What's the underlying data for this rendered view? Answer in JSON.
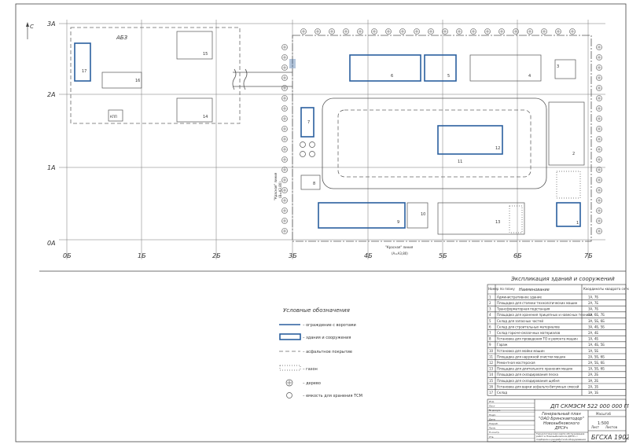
{
  "axes": {
    "rows": [
      "3А",
      "2А",
      "1А",
      "0А"
    ],
    "cols": [
      "0Б",
      "1Б",
      "2Б",
      "3Б",
      "4Б",
      "5Б",
      "6Б",
      "7Б"
    ],
    "north": "С"
  },
  "plan_labels": {
    "abz": "АБЗ",
    "kpp": "КПП",
    "red_line_1": "\"Красная\" линия",
    "red_line_1_coord": "(В=А3,80)",
    "red_line_2": "\"Красная\" линия",
    "red_line_2_coord": "(А=А3,80)"
  },
  "building_numbers": [
    "17",
    "16",
    "15",
    "14",
    "6",
    "5",
    "4",
    "3",
    "2",
    "1",
    "7",
    "8",
    "9",
    "10",
    "11",
    "12",
    "13"
  ],
  "legend": {
    "title": "Условные обозначения",
    "items": [
      {
        "icon": "fence-with-gate-icon",
        "text": "– ограждение с воротами"
      },
      {
        "icon": "building-outline-icon",
        "text": "– здания и сооружения"
      },
      {
        "icon": "dashed-line-icon",
        "text": "– асфальтное покрытие"
      },
      {
        "icon": "lawn-icon",
        "text": "– газон"
      },
      {
        "icon": "tree-icon",
        "text": "– дерево"
      },
      {
        "icon": "tank-icon",
        "text": "– емкость для хранения ТСМ"
      }
    ]
  },
  "explication": {
    "title": "Экспликация зданий и сооружений",
    "headers": [
      "Номер по плану",
      "Наименование",
      "Координаты квадрата сетки"
    ],
    "rows": [
      [
        "1",
        "Административное здание",
        "1А, 7Б"
      ],
      [
        "2",
        "Площадка для стоянки технологических машин",
        "2А, 7Б"
      ],
      [
        "3",
        "Трансформаторная подстанция",
        "3А, 7Б"
      ],
      [
        "4",
        "Площадка для хранения прицепных и навесных техники",
        "3А, 6Б, 7Б"
      ],
      [
        "5",
        "Склад для запасных частей",
        "3А, 5Б, 6Б"
      ],
      [
        "6",
        "Склад для строительных материалов",
        "3А, 4Б, 5Б"
      ],
      [
        "7",
        "Склад горюче-смазочных материалов",
        "2А, 4Б"
      ],
      [
        "8",
        "Установка для проведения ТО и ремонта машин",
        "1А, 4Б"
      ],
      [
        "9",
        "Гараж",
        "1А, 4Б, 5Б"
      ],
      [
        "10",
        "Установка для мойки машин",
        "1А, 5Б"
      ],
      [
        "11",
        "Площадка для наружной очистки машин",
        "2А, 5Б, 6Б"
      ],
      [
        "12",
        "Ремонтная мастерская",
        "2А, 5Б, 6Б"
      ],
      [
        "13",
        "Площадка для длительного хранения машин",
        "1А, 5Б, 6Б"
      ],
      [
        "14",
        "Площадка для складирования песка",
        "2А, 2Б"
      ],
      [
        "15",
        "Площадка для складирования щебня",
        "3А, 2Б"
      ],
      [
        "16",
        "Установка для варки асфальто-битумных смесей",
        "2А, 1Б"
      ],
      [
        "17",
        "Склад",
        "3А, 1Б"
      ]
    ]
  },
  "title_block": {
    "code": "ДП СКМЭСМ 522 000 000 ГП",
    "title": "Генеральный план \"ОАО Брянскавтодор\" Новозыбковского ДРСУч",
    "scale": "1:500",
    "sheet_label": "Лист",
    "sheets_label": "Листов",
    "mass_label": "Масштаб",
    "org": "БГСХА 190207",
    "description": "Технологическая карта обслуживания работ в Новозыбковском ДРСУч с подбором и разработкой оборудования для ремонта ТО и Р",
    "rows": [
      "Изм.",
      "Лист",
      "№ докум.",
      "Подп.",
      "Дата",
      "Разраб.",
      "Пров.",
      "Н.контр.",
      "Утв."
    ]
  }
}
